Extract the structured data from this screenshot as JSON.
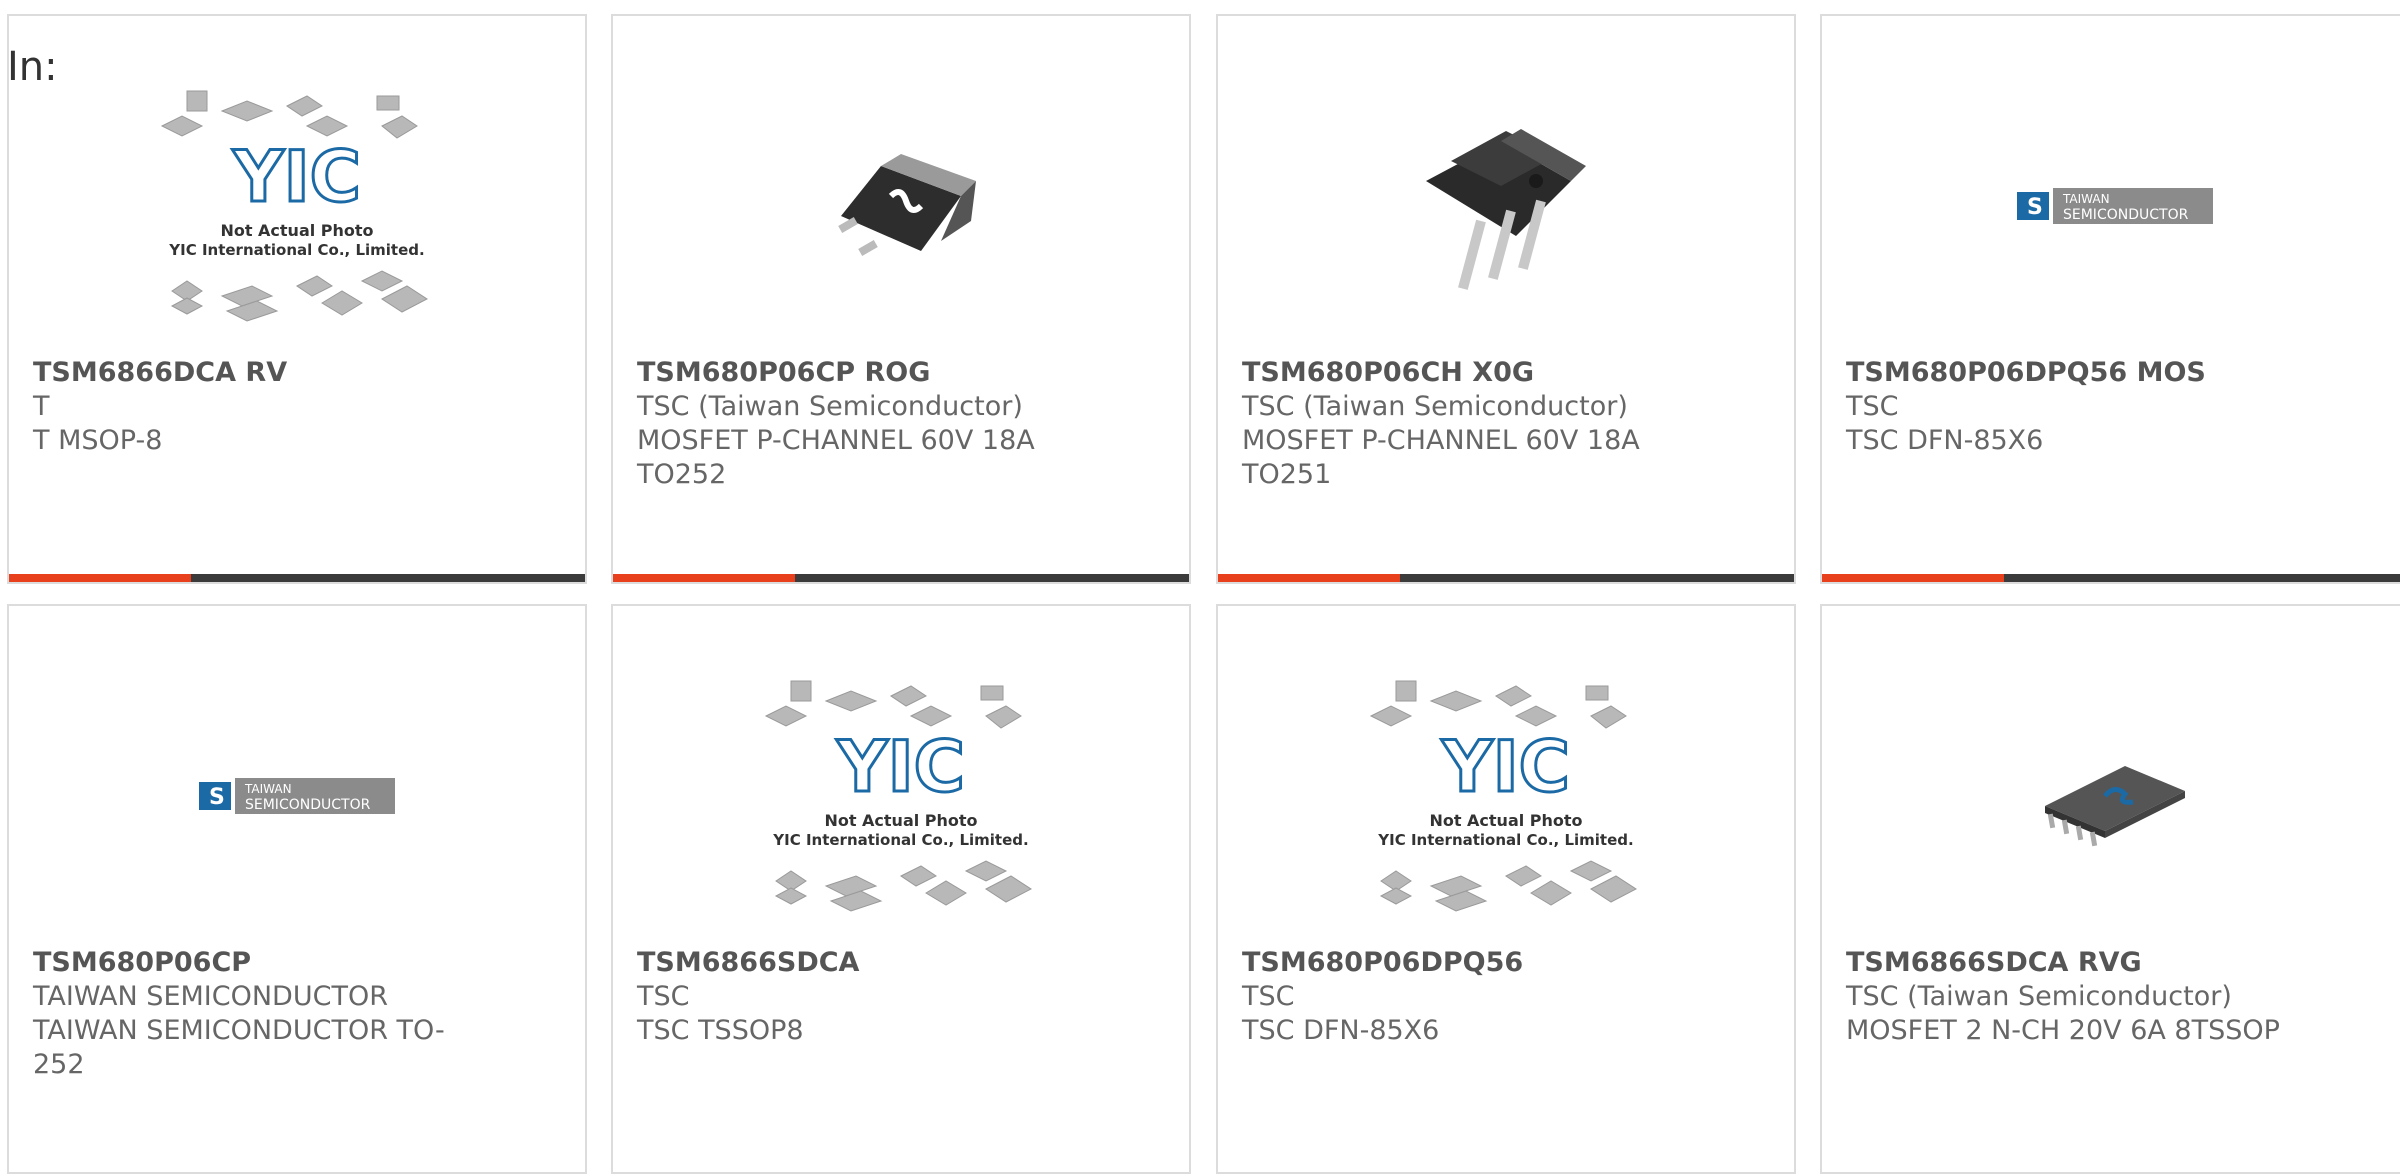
{
  "header": {
    "label": "In:"
  },
  "colors": {
    "accent": "#e8401c",
    "bar": "#3b3b3b",
    "border": "#dcdcdc",
    "logo_blue": "#1b6aa5"
  },
  "placeholder": {
    "line1": "Not Actual Photo",
    "line2": "YIC International Co., Limited.",
    "logo_text": "YIC"
  },
  "taiwan_logo": {
    "line1": "TAIWAN",
    "line2": "SEMICONDUCTOR"
  },
  "products": [
    {
      "name": "TSM6866DCA RV",
      "lines": [
        "T",
        "T MSOP-8"
      ],
      "image": "placeholder-image"
    },
    {
      "name": "TSM680P06CP ROG",
      "lines": [
        "TSC (Taiwan Semiconductor)",
        "MOSFET P-CHANNEL 60V 18A",
        "TO252"
      ],
      "image": "to252-package-image"
    },
    {
      "name": "TSM680P06CH X0G",
      "lines": [
        "TSC (Taiwan Semiconductor)",
        "MOSFET P-CHANNEL 60V 18A",
        "TO251"
      ],
      "image": "to251-package-image"
    },
    {
      "name": "TSM680P06DPQ56 MOS",
      "lines": [
        "TSC",
        "TSC DFN-85X6"
      ],
      "image": "taiwan-semiconductor-logo"
    },
    {
      "name": "TSM680P06CP",
      "lines": [
        "TAIWAN SEMICONDUCTOR",
        "TAIWAN SEMICONDUCTOR TO-",
        "252"
      ],
      "image": "taiwan-semiconductor-logo"
    },
    {
      "name": "TSM6866SDCA",
      "lines": [
        "TSC",
        "TSC TSSOP8"
      ],
      "image": "placeholder-image"
    },
    {
      "name": "TSM680P06DPQ56",
      "lines": [
        "TSC",
        "TSC DFN-85X6"
      ],
      "image": "placeholder-image"
    },
    {
      "name": "TSM6866SDCA RVG",
      "lines": [
        "TSC (Taiwan Semiconductor)",
        "MOSFET 2 N-CH 20V 6A 8TSSOP"
      ],
      "image": "tssop-package-image"
    }
  ]
}
